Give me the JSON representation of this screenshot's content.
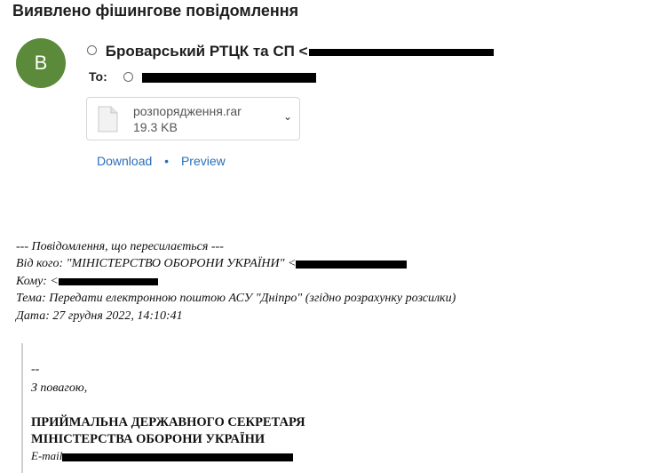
{
  "message": {
    "subject": "Виявлено фішингове повідомлення",
    "avatar_letter": "B",
    "sender_name": "Броварський РТЦК та СП",
    "sender_email_prefix": "<",
    "to_label": "To:"
  },
  "attachment": {
    "filename": "розпорядження.rar",
    "size": "19.3 KB",
    "download_label": "Download",
    "separator": "•",
    "preview_label": "Preview"
  },
  "forwarded": {
    "header": "--- Повідомлення, що пересилається ---",
    "from_label": "Від кого: \"МІНІСТЕРСТВО ОБОРОНИ УКРАЇНИ\" <",
    "to_label": "Кому: <",
    "subject_line": "Тема: Передати електронною поштою АСУ \"Дніпро\" (згідно розрахунку розсилки)",
    "date_line": "Дата: 27 грудня 2022, 14:10:41"
  },
  "signature": {
    "dash": "--",
    "regards": "З повагою,",
    "org_line1": "ПРИЙМАЛЬНА ДЕРЖАВНОГО СЕКРЕТАРЯ",
    "org_line2": "МІНІСТЕРСТВА ОБОРОНИ УКРАЇНИ",
    "email_label": "E-mail"
  },
  "colors": {
    "avatar": "#5a8a3a",
    "link": "#2a6ebb",
    "redaction": "#000000"
  },
  "icons": [
    "radio-icon",
    "file-icon",
    "chevron-down-icon"
  ]
}
